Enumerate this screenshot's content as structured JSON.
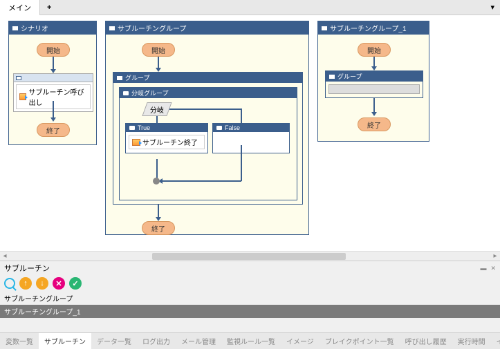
{
  "tabs": {
    "main": "メイン",
    "add": "+"
  },
  "groups": {
    "scenario": {
      "title": "シナリオ",
      "start": "開始",
      "end": "終了",
      "item": "サブルーチン呼び出し"
    },
    "subroutine": {
      "title": "サブルーチングループ",
      "start": "開始",
      "end": "終了",
      "inner": {
        "title": "グループ",
        "branch": {
          "title": "分岐グループ",
          "label": "分岐",
          "true": {
            "title": "True",
            "item": "サブルーチン終了"
          },
          "false": {
            "title": "False"
          }
        }
      }
    },
    "subroutine1": {
      "title": "サブルーチングループ_1",
      "start": "開始",
      "end": "終了",
      "inner": {
        "title": "グループ"
      }
    }
  },
  "panel": {
    "title": "サブルーチン",
    "rows": [
      "サブルーチングループ",
      "サブルーチングループ_1"
    ]
  },
  "bottom_tabs": [
    "変数一覧",
    "サブルーチン",
    "データ一覧",
    "ログ出力",
    "メール管理",
    "監視ルール一覧",
    "イメージ",
    "ブレイクポイント一覧",
    "呼び出し履歴",
    "実行時間",
    "イベント一覧"
  ],
  "colors": {
    "up": "#f5a623",
    "down": "#f5a623",
    "del": "#e6007e",
    "ok": "#2ab673"
  }
}
